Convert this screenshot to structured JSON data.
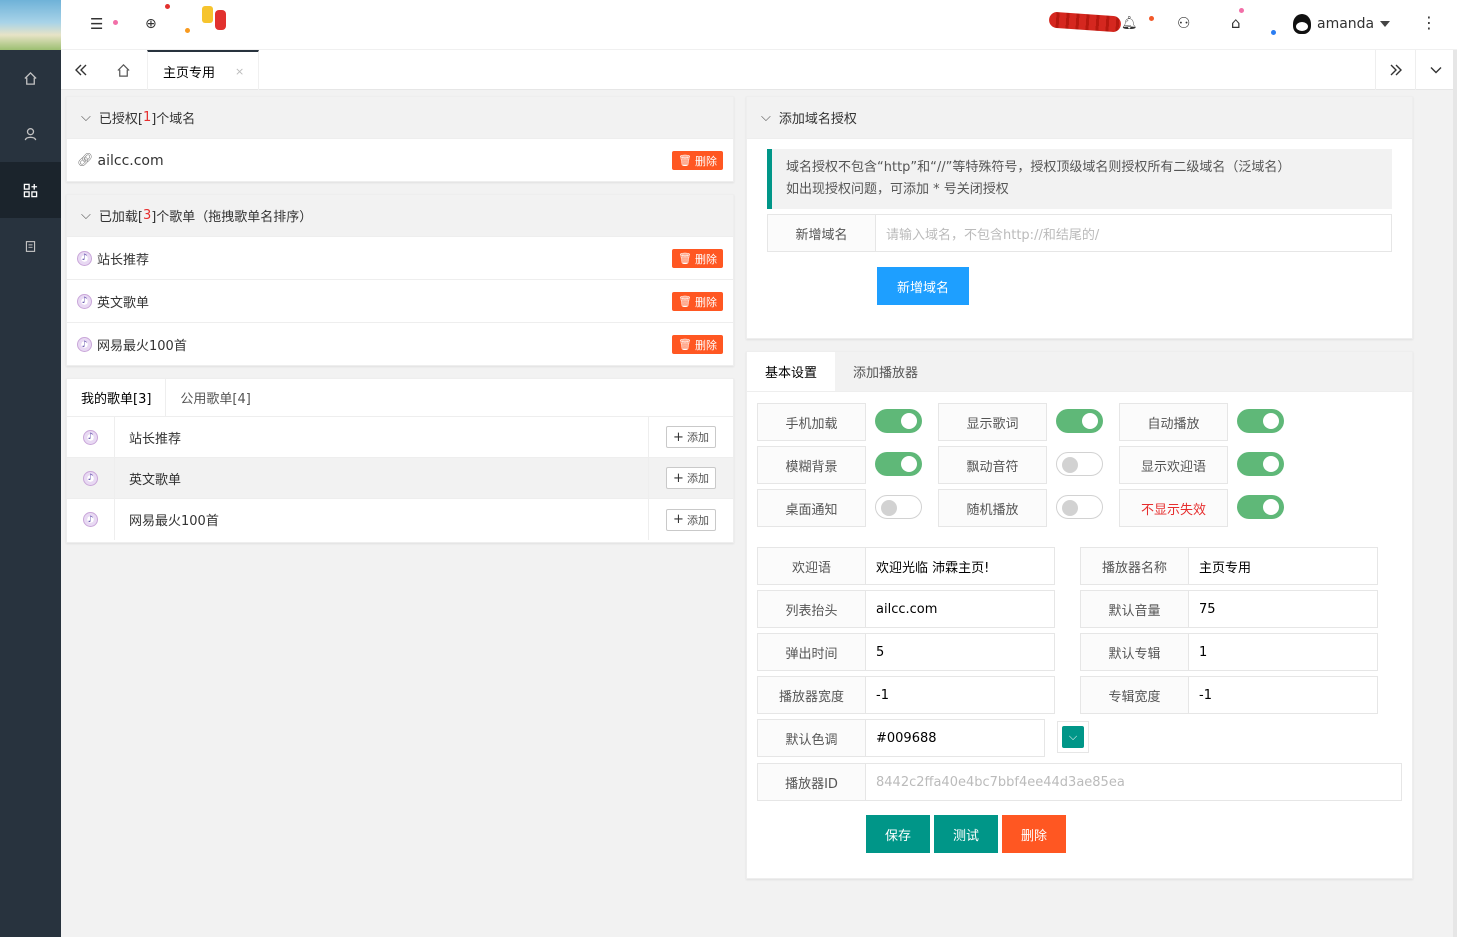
{
  "sidebar": {
    "items": [
      "home-icon",
      "user-icon",
      "apps-icon",
      "document-icon"
    ]
  },
  "header": {
    "username": "amanda"
  },
  "tabs": {
    "current": "主页专用",
    "close": "×"
  },
  "domains_card": {
    "title_prefix": "已授权[ ",
    "count": "1",
    "title_suffix": " ]个域名",
    "items": [
      {
        "name": "ailcc.com",
        "delete": "删除"
      }
    ]
  },
  "loaded_card": {
    "title_prefix": "已加载[ ",
    "count": "3",
    "title_suffix": " ]个歌单（拖拽歌单名排序）",
    "items": [
      {
        "name": "站长推荐",
        "delete": "删除"
      },
      {
        "name": "英文歌单",
        "delete": "删除"
      },
      {
        "name": "网易最火100首",
        "delete": "删除"
      }
    ]
  },
  "mylists": {
    "tab_mine": "我的歌单[3]",
    "tab_public": "公用歌单[4]",
    "rows": [
      {
        "name": "站长推荐",
        "add": "添加"
      },
      {
        "name": "英文歌单",
        "add": "添加"
      },
      {
        "name": "网易最火100首",
        "add": "添加"
      }
    ]
  },
  "add_domain": {
    "title": "添加域名授权",
    "notice_line1": "域名授权不包含“http”和“//”等特殊符号，授权顶级域名则授权所有二级域名（泛域名）",
    "notice_line2": "如出现授权问题，可添加 * 号关闭授权",
    "label": "新增域名",
    "placeholder": "请输入域名，不包含http://和结尾的/",
    "button": "新增域名"
  },
  "settings": {
    "tab_basic": "基本设置",
    "tab_add": "添加播放器",
    "switches": [
      {
        "label": "手机加载",
        "on": true
      },
      {
        "label": "显示歌词",
        "on": true
      },
      {
        "label": "自动播放",
        "on": true
      },
      {
        "label": "模糊背景",
        "on": true
      },
      {
        "label": "飘动音符",
        "on": false
      },
      {
        "label": "显示欢迎语",
        "on": true
      },
      {
        "label": "桌面通知",
        "on": false
      },
      {
        "label": "随机播放",
        "on": false
      },
      {
        "label": "不显示失效",
        "on": true
      }
    ],
    "fields": {
      "welcome_label": "欢迎语",
      "welcome_value": "欢迎光临 沛霖主页!",
      "player_name_label": "播放器名称",
      "player_name_value": "主页专用",
      "list_head_label": "列表抬头",
      "list_head_value": "ailcc.com",
      "volume_label": "默认音量",
      "volume_value": "75",
      "popup_label": "弹出时间",
      "popup_value": "5",
      "album_label": "默认专辑",
      "album_value": "1",
      "width_label": "播放器宽度",
      "width_value": "-1",
      "album_width_label": "专辑宽度",
      "album_width_value": "-1",
      "color_label": "默认色调",
      "color_value": "#009688",
      "id_label": "播放器ID",
      "id_value": "8442c2ffa40e4bc7bbf4ee44d3ae85ea"
    },
    "buttons": {
      "save": "保存",
      "test": "测试",
      "delete": "删除"
    }
  },
  "colors": {
    "accent": "#009688",
    "danger": "#ff5722",
    "blue": "#1e9fff",
    "switch_on": "#5fb878",
    "sidebar": "#28333e"
  }
}
